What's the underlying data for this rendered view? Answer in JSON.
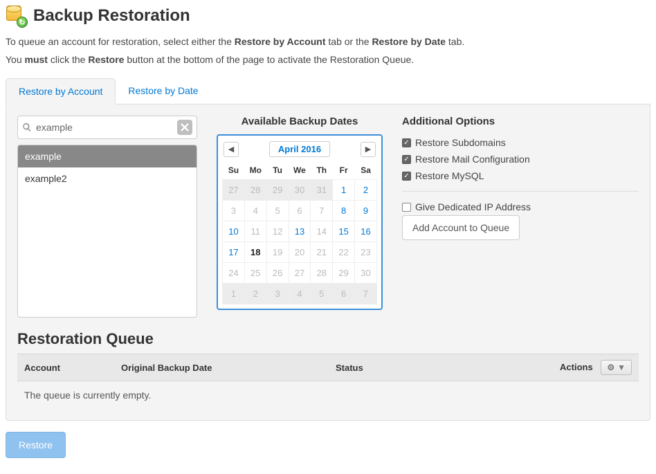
{
  "page": {
    "title": "Backup Restoration",
    "intro_prefix": "To queue an account for restoration, select either the ",
    "intro_bold1": "Restore by Account",
    "intro_mid": " tab or the ",
    "intro_bold2": "Restore by Date",
    "intro_suffix": " tab.",
    "must_prefix": "You ",
    "must_bold1": "must",
    "must_mid": " click the ",
    "must_bold2": "Restore",
    "must_suffix": " button at the bottom of the page to activate the Restoration Queue."
  },
  "tabs": {
    "account": "Restore by Account",
    "date": "Restore by Date",
    "active": "account"
  },
  "search": {
    "value": "example",
    "placeholder": "Search"
  },
  "accounts": [
    {
      "name": "example",
      "selected": true
    },
    {
      "name": "example2",
      "selected": false
    }
  ],
  "calendar": {
    "heading": "Available Backup Dates",
    "month_label": "April 2016",
    "dow": [
      "Su",
      "Mo",
      "Tu",
      "We",
      "Th",
      "Fr",
      "Sa"
    ],
    "weeks": [
      [
        {
          "d": 27,
          "other": true
        },
        {
          "d": 28,
          "other": true
        },
        {
          "d": 29,
          "other": true
        },
        {
          "d": 30,
          "other": true
        },
        {
          "d": 31,
          "other": true
        },
        {
          "d": 1,
          "avail": true
        },
        {
          "d": 2,
          "avail": true
        }
      ],
      [
        {
          "d": 3
        },
        {
          "d": 4
        },
        {
          "d": 5
        },
        {
          "d": 6
        },
        {
          "d": 7
        },
        {
          "d": 8,
          "avail": true
        },
        {
          "d": 9,
          "avail": true
        }
      ],
      [
        {
          "d": 10,
          "avail": true
        },
        {
          "d": 11
        },
        {
          "d": 12
        },
        {
          "d": 13,
          "avail": true
        },
        {
          "d": 14
        },
        {
          "d": 15,
          "avail": true
        },
        {
          "d": 16,
          "avail": true
        }
      ],
      [
        {
          "d": 17,
          "avail": true
        },
        {
          "d": 18,
          "today": true
        },
        {
          "d": 19
        },
        {
          "d": 20
        },
        {
          "d": 21
        },
        {
          "d": 22
        },
        {
          "d": 23
        }
      ],
      [
        {
          "d": 24
        },
        {
          "d": 25
        },
        {
          "d": 26
        },
        {
          "d": 27
        },
        {
          "d": 28
        },
        {
          "d": 29
        },
        {
          "d": 30
        }
      ],
      [
        {
          "d": 1,
          "other": true
        },
        {
          "d": 2,
          "other": true
        },
        {
          "d": 3,
          "other": true
        },
        {
          "d": 4,
          "other": true
        },
        {
          "d": 5,
          "other": true
        },
        {
          "d": 6,
          "other": true
        },
        {
          "d": 7,
          "other": true
        }
      ]
    ]
  },
  "options": {
    "heading": "Additional Options",
    "subdomains": {
      "label": "Restore Subdomains",
      "checked": true
    },
    "mail": {
      "label": "Restore Mail Configuration",
      "checked": true
    },
    "mysql": {
      "label": "Restore MySQL",
      "checked": true
    },
    "dedicated_ip": {
      "label": "Give Dedicated IP Address",
      "checked": false
    },
    "add_button": "Add Account to Queue"
  },
  "queue": {
    "heading": "Restoration Queue",
    "columns": {
      "account": "Account",
      "date": "Original Backup Date",
      "status": "Status",
      "actions": "Actions"
    },
    "empty_text": "The queue is currently empty."
  },
  "restore_button": "Restore"
}
